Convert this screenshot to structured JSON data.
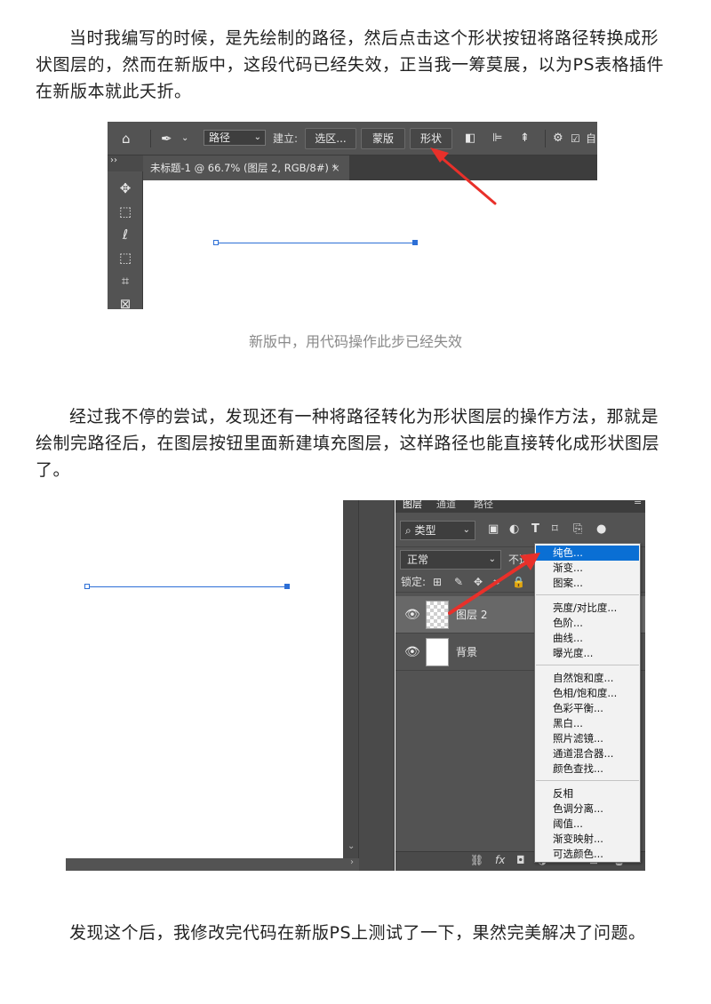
{
  "paragraphs": {
    "p1": "当时我编写的时候，是先绘制的路径，然后点击这个形状按钮将路径转换成形状图层的，然而在新版中，这段代码已经失效，正当我一筹莫展，以为PS表格插件在新版本就此夭折。",
    "p2": "经过我不停的尝试，发现还有一种将路径转化为形状图层的操作方法，那就是绘制完路径后，在图层按钮里面新建填充图层，这样路径也能直接转化成形状图层了。",
    "p3": "发现这个后，我修改完代码在新版PS上测试了一下，果然完美解决了问题。"
  },
  "caption1": "新版中，用代码操作此步已经失效",
  "shot1": {
    "path_mode": "路径",
    "make_label": "建立:",
    "selection_btn": "选区...",
    "mask_btn": "蒙版",
    "shape_btn": "形状",
    "auto_label": "自",
    "doc_tab": "未标题-1 @ 66.7% (图层 2, RGB/8#) *",
    "doc_tab_close": "×",
    "tools_collapse": "››",
    "icons": {
      "home": "home-icon",
      "pen": "pen-tool-icon",
      "move": "move-tool-icon",
      "marquee": "marquee-tool-icon",
      "lasso": "lasso-tool-icon",
      "object_select": "object-select-icon",
      "crop": "crop-tool-icon",
      "frame": "frame-tool-icon"
    },
    "arrow_color": "#e8302a"
  },
  "shot2": {
    "tabs": [
      "图层",
      "通道",
      "路径"
    ],
    "filter_kind": "类型",
    "blend_mode": "正常",
    "opacity_label": "不透明",
    "lock_label": "锁定:",
    "layers": [
      {
        "name": "图层 2",
        "selected": true
      },
      {
        "name": "背景",
        "selected": false
      }
    ],
    "bottom_fx": "fx",
    "menu_groups": [
      [
        "纯色...",
        "渐变...",
        "图案..."
      ],
      [
        "亮度/对比度...",
        "色阶...",
        "曲线...",
        "曝光度..."
      ],
      [
        "自然饱和度...",
        "色相/饱和度...",
        "色彩平衡...",
        "黑白...",
        "照片滤镜...",
        "通道混合器...",
        "颜色查找..."
      ],
      [
        "反相",
        "色调分离...",
        "阈值...",
        "渐变映射...",
        "可选颜色..."
      ]
    ],
    "highlight_color": "#0a6fd4",
    "path_color": "#2d6fd6"
  }
}
